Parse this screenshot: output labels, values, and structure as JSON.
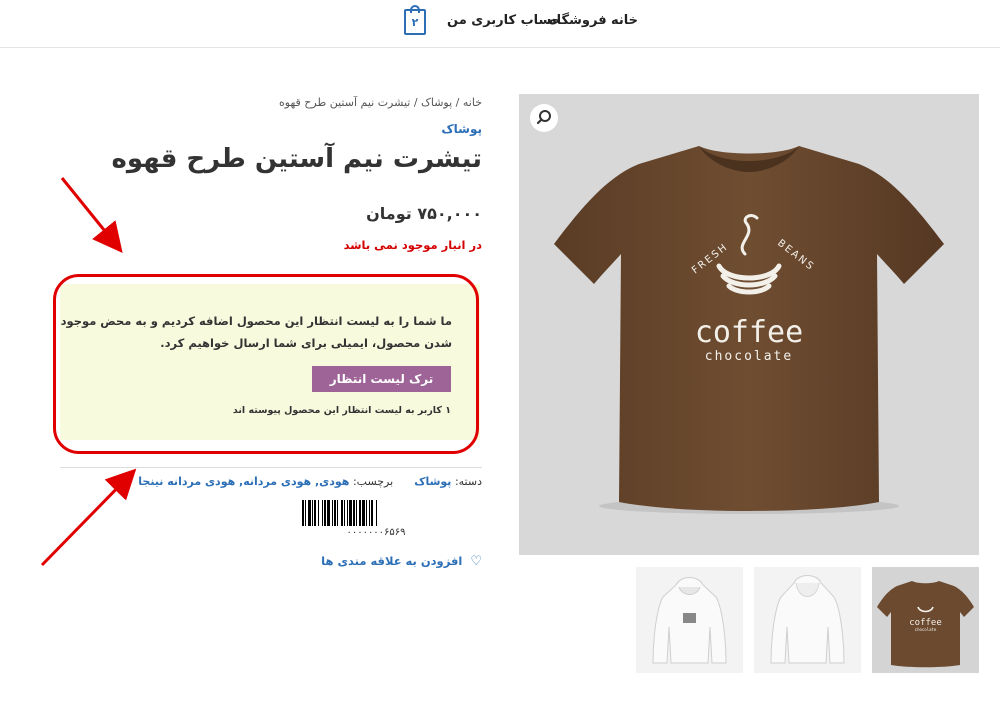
{
  "header": {
    "nav": [
      "خانه",
      "فروشگاه",
      "حساب کاربری من"
    ],
    "cart_count": "۲",
    "cart_icon": "shopping-bag-icon"
  },
  "breadcrumb": "خانه / پوشاک / تیشرت نیم آستین طرح قهوه",
  "category": "پوشاک",
  "product": {
    "title": "تیشرت نیم آستین طرح قهوه",
    "price": "۷۵۰,۰۰۰ تومان",
    "stock_status": "در انبار موجود نمی باشد"
  },
  "waitlist": {
    "message": "ما شما را به لیست انتظار این محصول اضافه کردیم و به محض موجود شدن محصول، ایمیلی برای شما ارسال خواهیم کرد.",
    "button": "ترک لیست انتظار",
    "subscriber_count": "۱ کاربر به لیست انتظار این محصول پیوسته اند"
  },
  "meta": {
    "category_label": "دسته:",
    "category_value": "پوشاک",
    "tags_label": "برچسب:",
    "tags_value": "هودی, هودی مردانه, هودی مردانه نینجا"
  },
  "barcode_number": "۰۰۰۰۰۰۰۶۵۶۹",
  "wishlist_label": "افزودن به علاقه مندی ها",
  "image_text": {
    "arc_left": "FRESH",
    "arc_right": "BEANS",
    "brand": "coffee",
    "sub": "chocolate"
  },
  "colors": {
    "link": "#2c6fb7",
    "stock_red": "#d40000",
    "button": "#9e6497",
    "notice_bg": "#f7fadd",
    "annotation_red": "#e00000",
    "shirt": "#6b4a30"
  }
}
